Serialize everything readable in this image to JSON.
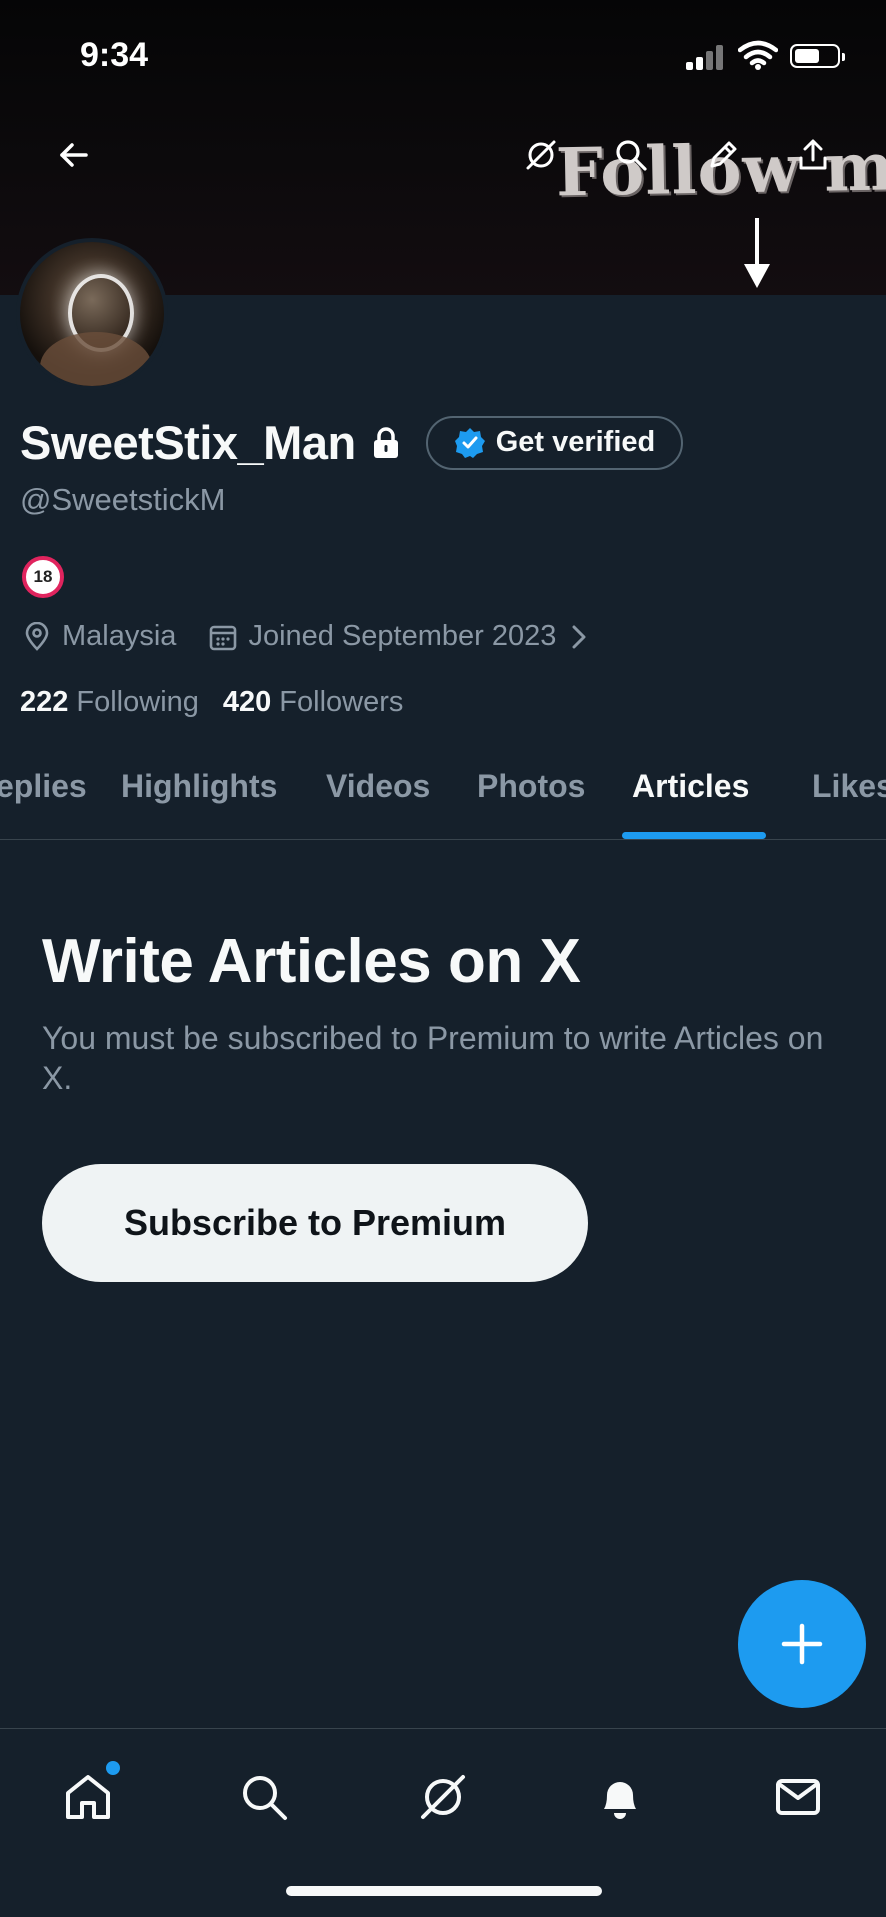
{
  "status_bar": {
    "time": "9:34",
    "battery_level": 0.6
  },
  "banner": {
    "text": "Follow me"
  },
  "header": {
    "back_icon": "arrow-left-icon",
    "actions": [
      "grok-icon",
      "search-icon",
      "edit-icon",
      "share-icon"
    ]
  },
  "profile": {
    "display_name": "SweetStix_Man",
    "handle": "@SweetstickM",
    "get_verified_label": "Get verified",
    "bio_emoji": "🔞",
    "location": "Malaysia",
    "joined": "Joined September 2023",
    "following_count": "222",
    "following_label": "Following",
    "followers_count": "420",
    "followers_label": "Followers"
  },
  "tabs": [
    "eplies",
    "Highlights",
    "Videos",
    "Photos",
    "Articles",
    "Likes"
  ],
  "active_tab": "Articles",
  "empty_state": {
    "title": "Write Articles on X",
    "subtitle": "You must be subscribed to Premium to write Articles on X.",
    "button_label": "Subscribe to Premium"
  },
  "bottom_nav": [
    "home-icon",
    "search-icon",
    "grok-icon",
    "notifications-icon",
    "messages-icon"
  ],
  "colors": {
    "background": "#15202b",
    "accent": "#1d9bf0",
    "muted_text": "#8b98a5",
    "border": "#38444d"
  }
}
